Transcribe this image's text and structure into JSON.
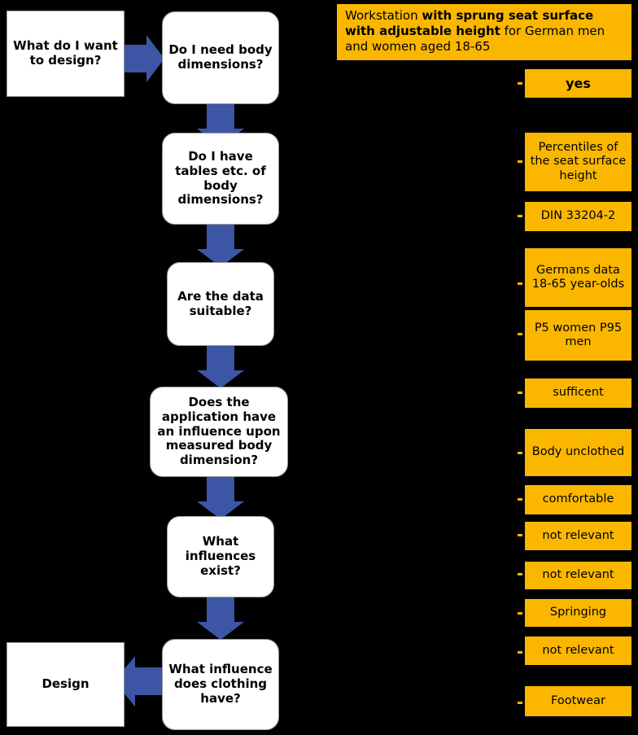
{
  "diagram": {
    "title_box": {
      "prefix": "Workstation ",
      "bold1": "with sprung seat surface with adjustable height",
      "suffix": " for German men and women aged 18-65",
      "full_text": "Workstation with sprung seat surface with adjustable height for German men and women aged 18-65",
      "bg_color": "#fbb700"
    },
    "colors": {
      "arrow_blue": "#3c56a5",
      "answer_orange": "#fbb700",
      "box_white": "#ffffff",
      "background": "#000000",
      "text": "#000000"
    },
    "flow_nodes": [
      {
        "id": "start",
        "label": "What do I want to design?",
        "shape": "rectangle"
      },
      {
        "id": "q1",
        "label": "Do I need body dimensions?",
        "shape": "rounded-rectangle"
      },
      {
        "id": "q2",
        "label": "Do I have tables etc. of body dimensions?",
        "shape": "rounded-rectangle"
      },
      {
        "id": "q3",
        "label": "Are the data suitable?",
        "shape": "rounded-rectangle"
      },
      {
        "id": "q4",
        "label": "Does the application have an influence upon measured body dimension?",
        "shape": "rounded-rectangle"
      },
      {
        "id": "q5",
        "label": "What influences exist?",
        "shape": "rounded-rectangle"
      },
      {
        "id": "q6",
        "label": "What influence does clothing have?",
        "shape": "rounded-rectangle"
      },
      {
        "id": "end",
        "label": "Design",
        "shape": "rectangle"
      }
    ],
    "answers": [
      {
        "id": "a1",
        "label": "yes",
        "bold": true
      },
      {
        "id": "a2",
        "label": "Percentiles of the seat surface height",
        "bold": false
      },
      {
        "id": "a3",
        "label": "DIN 33204-2",
        "bold": false
      },
      {
        "id": "a4",
        "label": "Germans data 18-65 year-olds",
        "bold": false
      },
      {
        "id": "a5",
        "label": "P5 women P95 men",
        "bold": false
      },
      {
        "id": "a6",
        "label": "sufficent",
        "bold": false
      },
      {
        "id": "a7",
        "label": "Body unclothed",
        "bold": false
      },
      {
        "id": "a8",
        "label": "comfortable",
        "bold": false
      },
      {
        "id": "a9",
        "label": "not relevant",
        "bold": false
      },
      {
        "id": "a10",
        "label": "not relevant",
        "bold": false
      },
      {
        "id": "a11",
        "label": "Springing",
        "bold": false
      },
      {
        "id": "a12",
        "label": "not relevant",
        "bold": false
      },
      {
        "id": "a13",
        "label": "Footwear",
        "bold": false
      }
    ]
  }
}
